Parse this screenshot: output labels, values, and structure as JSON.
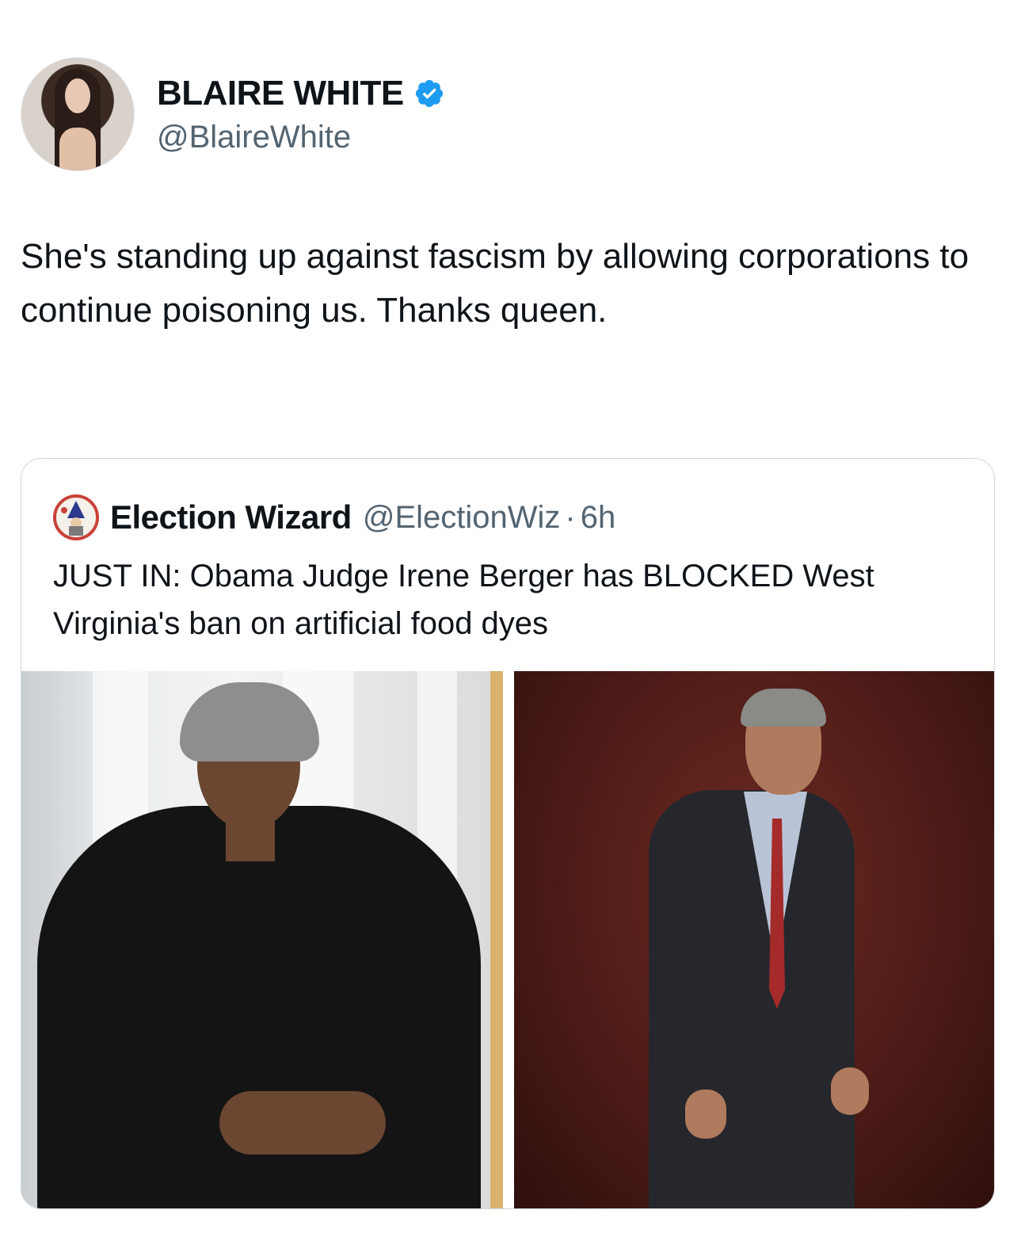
{
  "author": {
    "display_name": "BLAIRE WHITE",
    "handle": "@BlaireWhite",
    "verified_icon": "verified-badge-icon",
    "verified_color": "#1d9bf0"
  },
  "tweet": {
    "text": "She's standing up against fascism by allowing corporations to continue poisoning us. Thanks queen."
  },
  "quoted_tweet": {
    "display_name": "Election Wizard",
    "handle": "@ElectionWiz",
    "separator": "·",
    "time": "6h",
    "text": "JUST IN: Obama Judge Irene Berger has BLOCKED West Virginia's ban on artificial food dyes",
    "media": [
      {
        "name": "photo-judge"
      },
      {
        "name": "photo-man-in-suit"
      }
    ]
  },
  "colors": {
    "text_primary": "#0f1419",
    "text_secondary": "#536471",
    "border": "#cfd9de"
  }
}
